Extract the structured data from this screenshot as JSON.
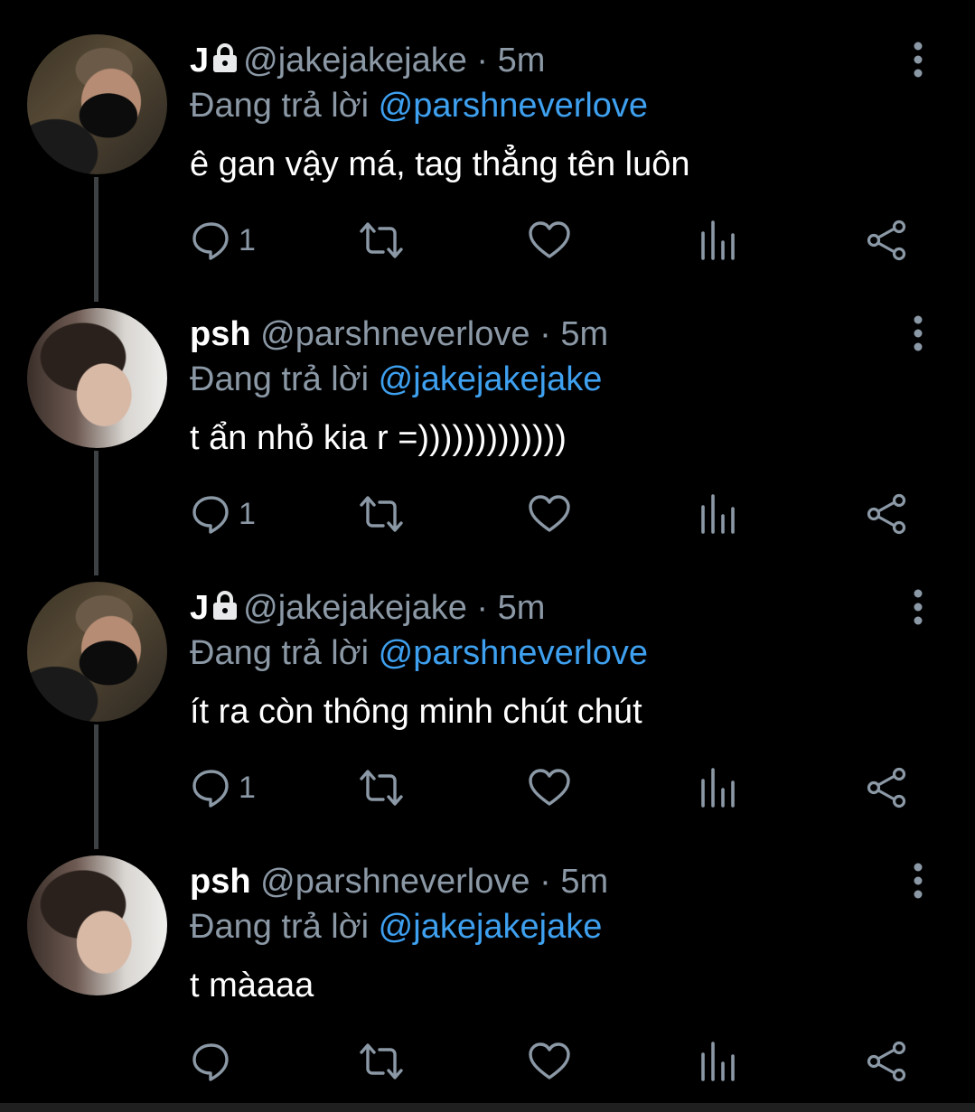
{
  "tweets": [
    {
      "name": "J",
      "protected": true,
      "handle": "@jakejakejake",
      "dot": "·",
      "time": "5m",
      "replying_prefix": "Đang trả lời",
      "replying_to": "@parshneverlove",
      "text": "ê gan vậy má, tag thẳng tên luôn",
      "reply_count": "1",
      "avatar": "jake"
    },
    {
      "name": "psh",
      "protected": false,
      "handle": "@parshneverlove",
      "dot": "·",
      "time": "5m",
      "replying_prefix": "Đang trả lời",
      "replying_to": "@jakejakejake",
      "text": "t ẩn nhỏ kia r =)))))))))))))",
      "reply_count": "1",
      "avatar": "psh"
    },
    {
      "name": "J",
      "protected": true,
      "handle": "@jakejakejake",
      "dot": "·",
      "time": "5m",
      "replying_prefix": "Đang trả lời",
      "replying_to": "@parshneverlove",
      "text": "ít ra còn thông minh chút chút",
      "reply_count": "1",
      "avatar": "jake"
    },
    {
      "name": "psh",
      "protected": false,
      "handle": "@parshneverlove",
      "dot": "·",
      "time": "5m",
      "replying_prefix": "Đang trả lời",
      "replying_to": "@jakejakejake",
      "text": "t màaaa",
      "reply_count": "",
      "avatar": "psh"
    }
  ],
  "colors": {
    "background": "#000000",
    "muted": "#8b98a5",
    "mention": "#3ea0ef",
    "thread_line": "#3e4144"
  },
  "icons": [
    "lock-icon",
    "more-icon",
    "reply-icon",
    "retweet-icon",
    "like-icon",
    "stats-icon",
    "share-icon"
  ]
}
